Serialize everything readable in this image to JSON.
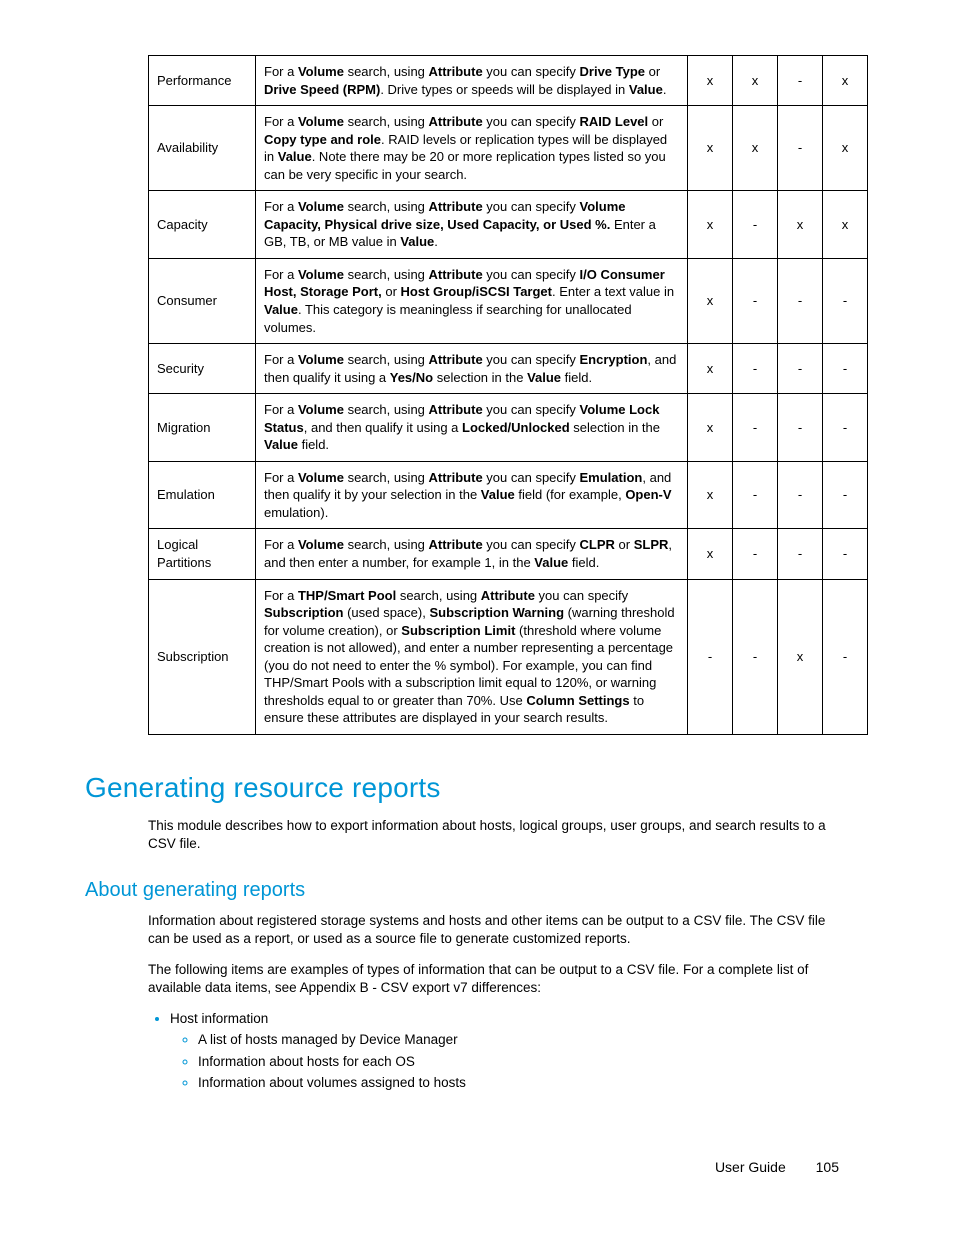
{
  "table": {
    "rows": [
      {
        "name": "Performance",
        "desc": "For a <b>Volume</b> search, using <b>Attribute</b> you can specify <b>Drive Type</b> or <b>Drive Speed (RPM)</b>. Drive types or speeds will be displayed in <b>Value</b>.",
        "flags": [
          "x",
          "x",
          "-",
          "x"
        ]
      },
      {
        "name": "Availability",
        "desc": "For a <b>Volume</b> search, using <b>Attribute</b> you can specify <b>RAID Level</b> or <b>Copy type and role</b>. RAID levels or replication types will be displayed in <b>Value</b>. Note there may be 20 or more replication types listed so you can be very specific in your search.",
        "flags": [
          "x",
          "x",
          "-",
          "x"
        ]
      },
      {
        "name": "Capacity",
        "desc": "For a <b>Volume</b> search, using <b>Attribute</b> you can specify <b>Volume Capacity, Physical drive size, Used Capacity, or Used %.</b> Enter a GB, TB, or MB value in <b>Value</b>.",
        "flags": [
          "x",
          "-",
          "x",
          "x"
        ]
      },
      {
        "name": "Consumer",
        "desc": "For a <b>Volume</b> search, using <b>Attribute</b> you can specify <b>I/O Consumer Host, Storage Port,</b> or <b>Host Group/iSCSI Target</b>. Enter a text value in <b>Value</b>. This category is meaningless if searching for unallocated volumes.",
        "flags": [
          "x",
          "-",
          "-",
          "-"
        ]
      },
      {
        "name": "Security",
        "desc": "For a <b>Volume</b> search, using <b>Attribute</b> you can specify <b>Encryption</b>, and then qualify it using a <b>Yes/No</b> selection in the <b>Value</b> field.",
        "flags": [
          "x",
          "-",
          "-",
          "-"
        ]
      },
      {
        "name": "Migration",
        "desc": "For a <b>Volume</b> search, using <b>Attribute</b> you can specify <b>Volume Lock Status</b>, and then qualify it using a <b>Locked/Unlocked</b> selection in the <b>Value</b> field.",
        "flags": [
          "x",
          "-",
          "-",
          "-"
        ]
      },
      {
        "name": "Emulation",
        "desc": "For a <b>Volume</b> search, using <b>Attribute</b> you can specify <b>Emulation</b>, and then qualify it by your selection in the <b>Value</b> field (for example, <b>Open-V</b> emulation).",
        "flags": [
          "x",
          "-",
          "-",
          "-"
        ]
      },
      {
        "name": "Logical Partitions",
        "desc": "For a <b>Volume</b> search, using <b>Attribute</b> you can specify <b>CLPR</b> or <b>SLPR</b>, and then enter a number, for example 1, in the <b>Value</b> field.",
        "flags": [
          "x",
          "-",
          "-",
          "-"
        ]
      },
      {
        "name": "Subscription",
        "desc": "For a <b>THP/Smart Pool</b> search, using <b>Attribute</b> you can specify <b>Subscription</b> (used space), <b>Subscription Warning</b> (warning threshold for volume creation), or <b>Subscription Limit</b> (threshold where volume creation is not allowed), and enter a number representing a percentage (you do not need to enter the % symbol). For example, you can find THP/Smart Pools with a subscription limit equal to 120%, or warning thresholds equal to or greater than 70%. Use <b>Column Settings</b> to ensure these attributes are displayed in your search results.",
        "flags": [
          "-",
          "-",
          "x",
          "-"
        ]
      }
    ]
  },
  "heading1": "Generating resource reports",
  "intro1": "This module describes how to export information about hosts, logical groups, user groups, and search results to a CSV file.",
  "heading2": "About generating reports",
  "para2a": "Information about registered storage systems and hosts and other items can be output to a CSV file. The CSV file can be used as a report, or used as a source file to generate customized reports.",
  "para2b": "The following items are examples of types of information that can be output to a CSV file. For a complete list of available data items, see Appendix B - CSV export v7 differences:",
  "list_l1_0": "Host information",
  "list_l2_0": "A list of hosts managed by Device Manager",
  "list_l2_1": "Information about hosts for each OS",
  "list_l2_2": "Information about volumes assigned to hosts",
  "footer_label": "User Guide",
  "page_number": "105"
}
